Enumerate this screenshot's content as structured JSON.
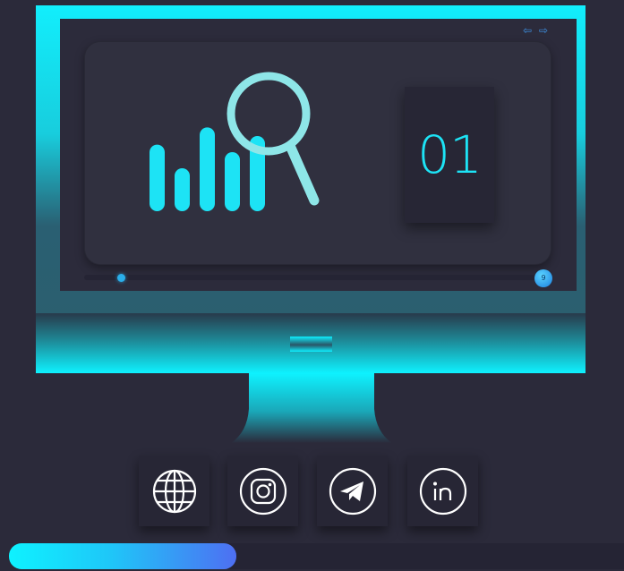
{
  "screen": {
    "nav": {
      "prev_icon": "arrow-left-icon",
      "next_icon": "arrow-right-icon",
      "prev_glyph": "⇦",
      "next_glyph": "⇨",
      "color": "#3d8fe0"
    },
    "illustration": {
      "icon": "bar-chart-magnifier-icon",
      "bar_levels": [
        0.62,
        0.4,
        0.78,
        0.55,
        0.7
      ],
      "color": "#1de3f5"
    },
    "slide_number": "01",
    "slide_progress": {
      "position": 0.08,
      "end_marker_label": "9"
    }
  },
  "social_links": [
    {
      "id": "website",
      "icon": "globe-icon"
    },
    {
      "id": "instagram",
      "icon": "instagram-icon"
    },
    {
      "id": "telegram",
      "icon": "telegram-icon"
    },
    {
      "id": "linkedin",
      "icon": "linkedin-icon"
    }
  ],
  "page_progress": {
    "fraction": 0.37,
    "colors": [
      "#0ef2ff",
      "#4e6ff2"
    ]
  },
  "colors": {
    "background": "#2b2a3a",
    "accent_cyan": "#0ef2ff",
    "accent_blue": "#4e6ff2",
    "card": "#272635"
  }
}
